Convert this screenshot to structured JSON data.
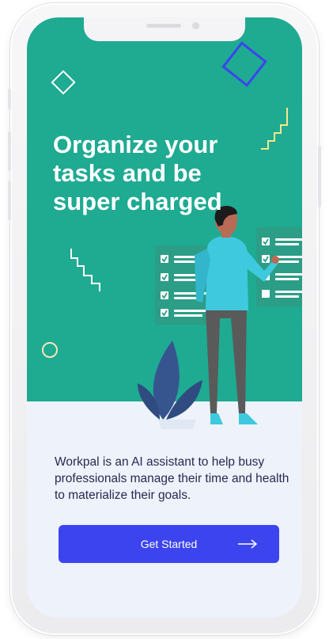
{
  "onboarding": {
    "headline": "Organize your tasks and be super charged",
    "description": "Workpal is an AI assistant to help busy professionals manage their time and health to materialize their goals.",
    "cta_label": "Get Started",
    "cta_icon": "arrow-right-icon"
  },
  "colors": {
    "hero_background": "#1faa92",
    "screen_background": "#eef2fb",
    "cta_background": "#3c44f0",
    "body_text": "#262a4f",
    "accent_blue": "#3c44f0",
    "accent_yellow": "#f4e88a",
    "person_shirt": "#3ec9de"
  },
  "icons": [
    "diamond-outline-icon",
    "stairs-icon",
    "circle-outline-icon",
    "checklist-icon",
    "plant-icon",
    "person-icon"
  ]
}
